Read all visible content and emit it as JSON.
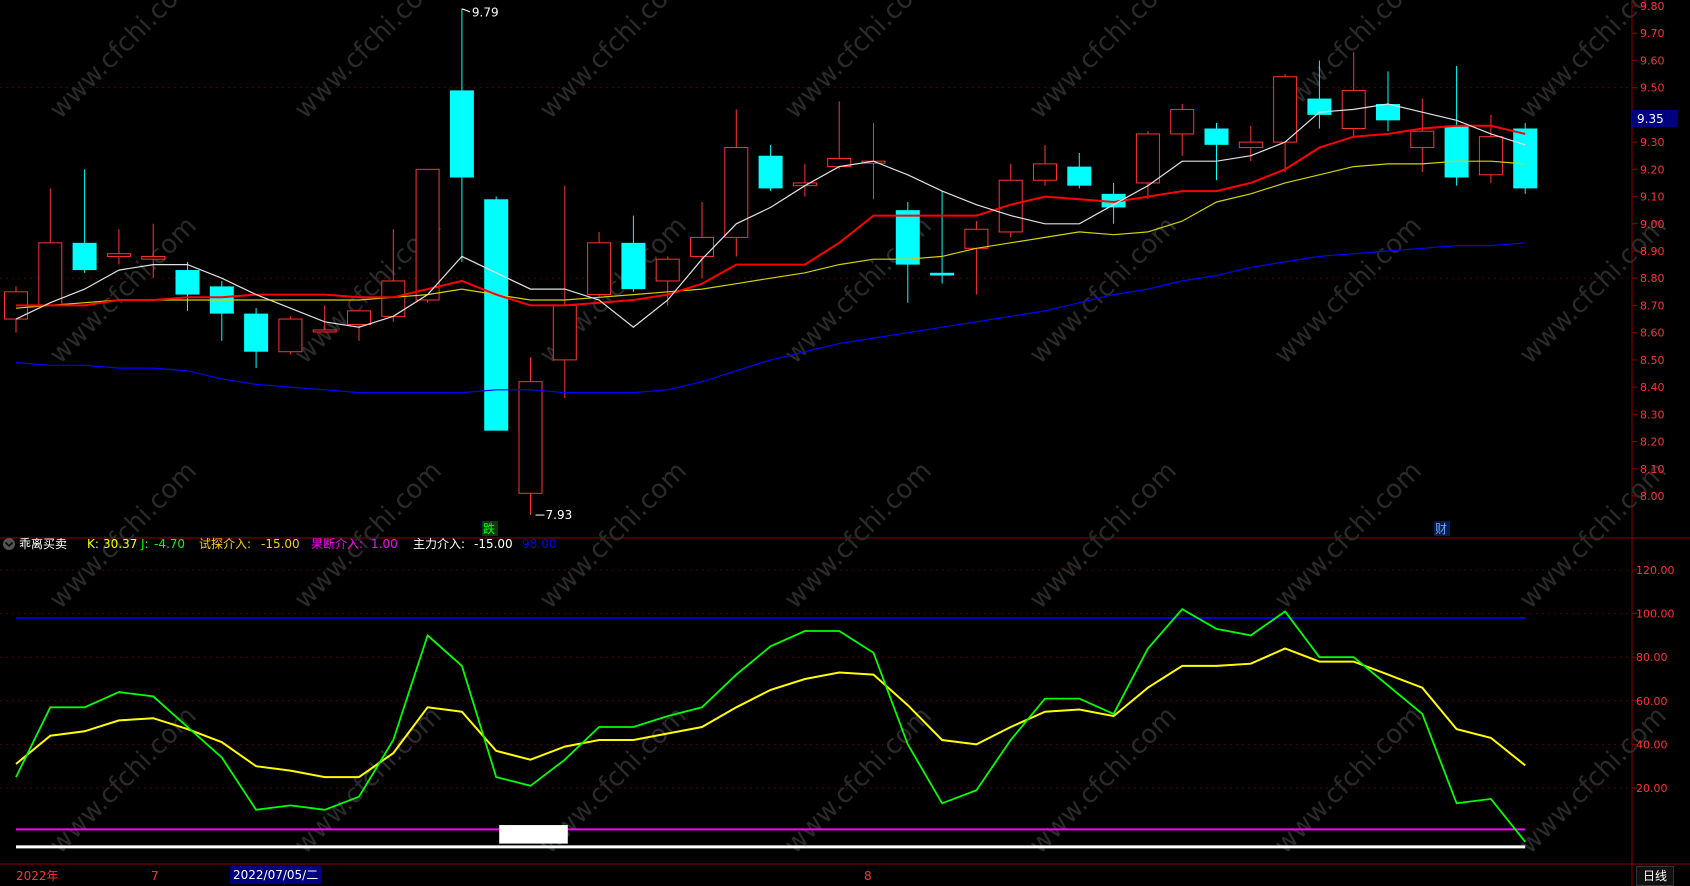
{
  "price_panel": {
    "high_marker": "9.79",
    "low_marker": "7.93",
    "current_price": "9.35",
    "tag_die": "跌",
    "tag_cai": "财",
    "y_ticks": [
      "9.80",
      "9.70",
      "9.60",
      "9.50",
      "9.40",
      "9.30",
      "9.20",
      "9.10",
      "9.00",
      "8.90",
      "8.80",
      "8.70",
      "8.60",
      "8.50",
      "8.40",
      "8.30",
      "8.20",
      "8.10",
      "8.00"
    ]
  },
  "indicator_header": {
    "name": "乖离买卖",
    "k_label": "K:",
    "k_value": "30.37",
    "j_label": "J:",
    "j_value": "-4.70",
    "trial_label": "试探介入:",
    "trial_value": "-15.00",
    "decisive_label": "果断介入:",
    "decisive_value": "1.00",
    "main_label": "主力介入:",
    "main_value": "-15.00",
    "level_value": "98.00"
  },
  "indicator_panel": {
    "y_ticks": [
      "120.00",
      "100.00",
      "80.00",
      "60.00",
      "40.00",
      "20.00"
    ]
  },
  "bottom_axis": {
    "year_label": "2022年",
    "month_7": "7",
    "selected_date": "2022/07/05/二",
    "month_8": "8",
    "period_tab": "日线"
  },
  "watermark": "www.cfchi.com",
  "colors": {
    "up": "#ff3232",
    "down": "#00ffff",
    "ma_white": "#e0e0e0",
    "ma_red": "#ff0000",
    "ma_yellow": "#d2d200",
    "ma_blue": "#0000ff",
    "k_line": "#ffff00",
    "j_line": "#00ff00",
    "level_line": "#0000ff",
    "decisive_line": "#ff00ff"
  },
  "chart_data": [
    {
      "type": "candlestick",
      "ylim": [
        7.9,
        9.83
      ],
      "candles": [
        {
          "o": 8.65,
          "h": 8.77,
          "l": 8.6,
          "c": 8.75
        },
        {
          "o": 8.7,
          "h": 9.13,
          "l": 8.7,
          "c": 8.93
        },
        {
          "o": 8.93,
          "h": 9.2,
          "l": 8.82,
          "c": 8.83
        },
        {
          "o": 8.88,
          "h": 8.98,
          "l": 8.85,
          "c": 8.89
        },
        {
          "o": 8.87,
          "h": 9.0,
          "l": 8.8,
          "c": 8.88
        },
        {
          "o": 8.83,
          "h": 8.86,
          "l": 8.68,
          "c": 8.74
        },
        {
          "o": 8.77,
          "h": 8.79,
          "l": 8.57,
          "c": 8.67
        },
        {
          "o": 8.67,
          "h": 8.69,
          "l": 8.47,
          "c": 8.53
        },
        {
          "o": 8.53,
          "h": 8.66,
          "l": 8.52,
          "c": 8.65
        },
        {
          "o": 8.61,
          "h": 8.7,
          "l": 8.6,
          "c": 8.61
        },
        {
          "o": 8.63,
          "h": 8.68,
          "l": 8.57,
          "c": 8.68
        },
        {
          "o": 8.66,
          "h": 8.98,
          "l": 8.64,
          "c": 8.79
        },
        {
          "o": 8.72,
          "h": 9.2,
          "l": 8.71,
          "c": 9.2
        },
        {
          "o": 9.49,
          "h": 9.79,
          "l": 8.86,
          "c": 9.17
        },
        {
          "o": 9.09,
          "h": 9.1,
          "l": 8.24,
          "c": 8.24
        },
        {
          "o": 8.01,
          "h": 8.51,
          "l": 7.93,
          "c": 8.42
        },
        {
          "o": 8.5,
          "h": 9.14,
          "l": 8.36,
          "c": 8.7
        },
        {
          "o": 8.74,
          "h": 8.97,
          "l": 8.73,
          "c": 8.93
        },
        {
          "o": 8.93,
          "h": 9.03,
          "l": 8.75,
          "c": 8.76
        },
        {
          "o": 8.79,
          "h": 8.88,
          "l": 8.7,
          "c": 8.87
        },
        {
          "o": 8.88,
          "h": 9.08,
          "l": 8.8,
          "c": 8.95
        },
        {
          "o": 8.95,
          "h": 9.42,
          "l": 8.88,
          "c": 9.28
        },
        {
          "o": 9.25,
          "h": 9.29,
          "l": 9.12,
          "c": 9.13
        },
        {
          "o": 9.14,
          "h": 9.22,
          "l": 9.1,
          "c": 9.15
        },
        {
          "o": 9.21,
          "h": 9.45,
          "l": 9.2,
          "c": 9.24
        },
        {
          "o": 9.23,
          "h": 9.37,
          "l": 9.09,
          "c": 9.23
        },
        {
          "o": 9.05,
          "h": 9.08,
          "l": 8.71,
          "c": 8.85
        },
        {
          "o": 8.82,
          "h": 9.12,
          "l": 8.78,
          "c": 8.81
        },
        {
          "o": 8.91,
          "h": 9.01,
          "l": 8.74,
          "c": 8.98
        },
        {
          "o": 8.97,
          "h": 9.22,
          "l": 8.95,
          "c": 9.16
        },
        {
          "o": 9.16,
          "h": 9.29,
          "l": 9.14,
          "c": 9.22
        },
        {
          "o": 9.21,
          "h": 9.26,
          "l": 9.13,
          "c": 9.14
        },
        {
          "o": 9.11,
          "h": 9.15,
          "l": 9.0,
          "c": 9.06
        },
        {
          "o": 9.15,
          "h": 9.34,
          "l": 9.09,
          "c": 9.33
        },
        {
          "o": 9.33,
          "h": 9.44,
          "l": 9.25,
          "c": 9.42
        },
        {
          "o": 9.35,
          "h": 9.37,
          "l": 9.16,
          "c": 9.29
        },
        {
          "o": 9.28,
          "h": 9.36,
          "l": 9.23,
          "c": 9.3
        },
        {
          "o": 9.3,
          "h": 9.55,
          "l": 9.19,
          "c": 9.54
        },
        {
          "o": 9.46,
          "h": 9.6,
          "l": 9.35,
          "c": 9.4
        },
        {
          "o": 9.35,
          "h": 9.63,
          "l": 9.32,
          "c": 9.49
        },
        {
          "o": 9.44,
          "h": 9.56,
          "l": 9.34,
          "c": 9.38
        },
        {
          "o": 9.28,
          "h": 9.46,
          "l": 9.19,
          "c": 9.34
        },
        {
          "o": 9.36,
          "h": 9.58,
          "l": 9.14,
          "c": 9.17
        },
        {
          "o": 9.18,
          "h": 9.4,
          "l": 9.15,
          "c": 9.32
        },
        {
          "o": 9.35,
          "h": 9.37,
          "l": 9.11,
          "c": 9.13
        }
      ],
      "ma_white": [
        8.65,
        8.71,
        8.76,
        8.83,
        8.85,
        8.85,
        8.8,
        8.74,
        8.69,
        8.64,
        8.62,
        8.66,
        8.74,
        8.88,
        8.82,
        8.76,
        8.76,
        8.72,
        8.62,
        8.72,
        8.87,
        9.0,
        9.06,
        9.14,
        9.21,
        9.23,
        9.18,
        9.12,
        9.07,
        9.03,
        9.0,
        9.0,
        9.07,
        9.14,
        9.23,
        9.23,
        9.25,
        9.3,
        9.41,
        9.42,
        9.44,
        9.41,
        9.38,
        9.33,
        9.29
      ],
      "ma_red": [
        8.7,
        8.7,
        8.7,
        8.72,
        8.72,
        8.73,
        8.73,
        8.74,
        8.74,
        8.74,
        8.73,
        8.73,
        8.76,
        8.79,
        8.74,
        8.7,
        8.7,
        8.71,
        8.72,
        8.74,
        8.78,
        8.85,
        8.85,
        8.85,
        8.93,
        9.03,
        9.03,
        9.03,
        9.03,
        9.07,
        9.1,
        9.09,
        9.08,
        9.1,
        9.12,
        9.12,
        9.15,
        9.2,
        9.28,
        9.32,
        9.33,
        9.35,
        9.36,
        9.36,
        9.33
      ],
      "ma_yellow": [
        8.69,
        8.7,
        8.71,
        8.72,
        8.72,
        8.72,
        8.72,
        8.72,
        8.72,
        8.72,
        8.72,
        8.73,
        8.74,
        8.76,
        8.74,
        8.72,
        8.72,
        8.73,
        8.74,
        8.75,
        8.76,
        8.78,
        8.8,
        8.82,
        8.85,
        8.87,
        8.87,
        8.88,
        8.91,
        8.93,
        8.95,
        8.97,
        8.96,
        8.97,
        9.01,
        9.08,
        9.11,
        9.15,
        9.18,
        9.21,
        9.22,
        9.22,
        9.23,
        9.23,
        9.22
      ],
      "ma_blue": [
        8.49,
        8.48,
        8.48,
        8.47,
        8.47,
        8.46,
        8.43,
        8.41,
        8.4,
        8.39,
        8.38,
        8.38,
        8.38,
        8.38,
        8.39,
        8.39,
        8.38,
        8.38,
        8.38,
        8.39,
        8.42,
        8.46,
        8.5,
        8.53,
        8.56,
        8.58,
        8.6,
        8.62,
        8.64,
        8.66,
        8.68,
        8.71,
        8.74,
        8.76,
        8.79,
        8.81,
        8.84,
        8.86,
        8.88,
        8.89,
        8.9,
        8.91,
        8.92,
        8.92,
        8.93
      ]
    },
    {
      "type": "line",
      "ylim": [
        -5,
        130
      ],
      "series": [
        {
          "name": "K",
          "values": [
            31,
            44,
            46,
            51,
            52,
            47,
            41,
            30,
            28,
            25,
            25,
            36,
            57,
            55,
            37,
            33,
            39,
            42,
            42,
            45,
            48,
            57,
            65,
            70,
            73,
            72,
            58,
            42,
            40,
            48,
            55,
            56,
            53,
            66,
            76,
            76,
            77,
            84,
            78,
            78,
            72,
            66,
            47,
            43,
            30.37
          ]
        },
        {
          "name": "J",
          "values": [
            25,
            57,
            57,
            64,
            62,
            48,
            34,
            10,
            12,
            10,
            16,
            42,
            90,
            76,
            25,
            21,
            33,
            48,
            48,
            53,
            57,
            72,
            85,
            92,
            92,
            82,
            40,
            13,
            19,
            42,
            61,
            61,
            54,
            84,
            102,
            93,
            90,
            101,
            80,
            80,
            67,
            54,
            13,
            15,
            -4.7
          ]
        }
      ],
      "levels": {
        "upper": 98.0,
        "lower": 1.0
      }
    }
  ]
}
